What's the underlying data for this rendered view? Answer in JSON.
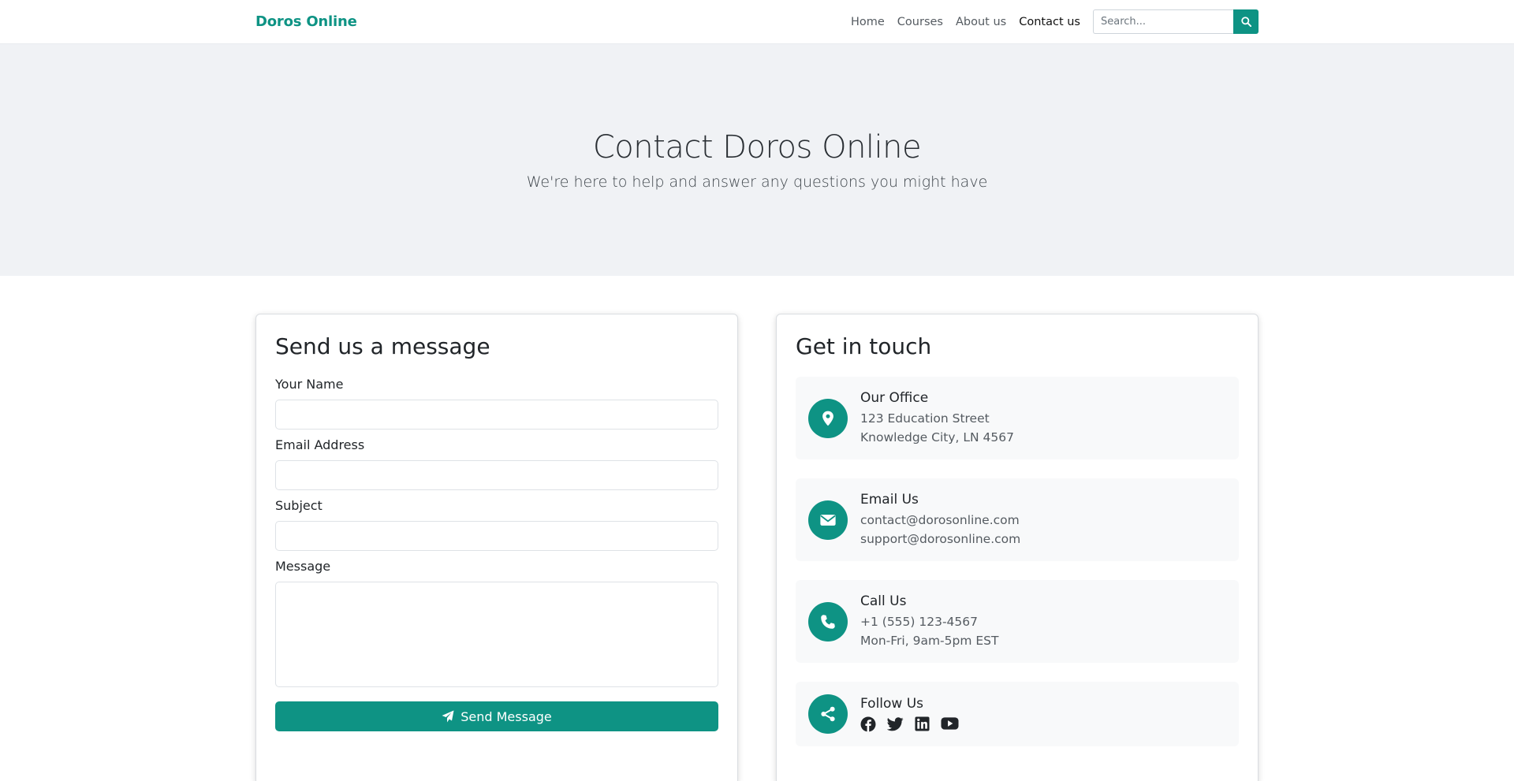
{
  "nav": {
    "brand": "Doros Online",
    "links": [
      {
        "label": "Home",
        "active": false
      },
      {
        "label": "Courses",
        "active": false
      },
      {
        "label": "About us",
        "active": false
      },
      {
        "label": "Contact us",
        "active": true
      }
    ],
    "search_placeholder": "Search..."
  },
  "hero": {
    "title": "Contact Doros Online",
    "subtitle": "We're here to help and answer any questions you might have"
  },
  "form": {
    "title": "Send us a message",
    "name_label": "Your Name",
    "email_label": "Email Address",
    "subject_label": "Subject",
    "message_label": "Message",
    "submit_label": "Send Message"
  },
  "contact": {
    "title": "Get in touch",
    "office": {
      "title": "Our Office",
      "line1": "123 Education Street",
      "line2": "Knowledge City, LN 4567"
    },
    "email": {
      "title": "Email Us",
      "line1": "contact@dorosonline.com",
      "line2": "support@dorosonline.com"
    },
    "phone": {
      "title": "Call Us",
      "line1": "+1 (555) 123-4567",
      "line2": "Mon-Fri, 9am-5pm EST"
    },
    "follow": {
      "title": "Follow Us",
      "icons": [
        "facebook-icon",
        "twitter-icon",
        "linkedin-icon",
        "youtube-icon"
      ]
    }
  },
  "colors": {
    "accent": "#0e9384",
    "hero_bg": "#f0f2f5",
    "info_bg": "#f8f9fa"
  }
}
